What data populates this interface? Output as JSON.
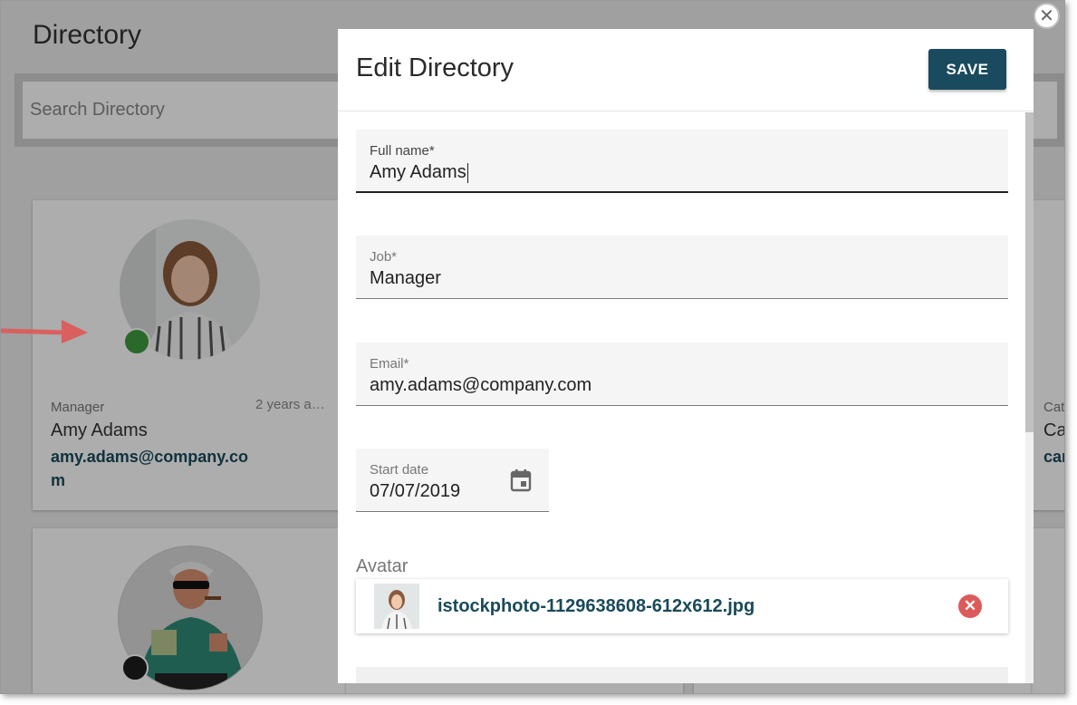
{
  "background": {
    "title": "Directory",
    "search_placeholder": "Search Directory",
    "cards": [
      {
        "job": "Manager",
        "time": "2 years a…",
        "name": "Amy Adams",
        "email": "amy.adams@company.com",
        "status_color": "#3f9b3f"
      },
      {
        "status_color": "#1d1d1d"
      }
    ],
    "partial_card": {
      "category": "Cat",
      "name": "Ca",
      "email": "cam"
    }
  },
  "dialog": {
    "title": "Edit Directory",
    "save_label": "SAVE",
    "fields": {
      "full_name": {
        "label": "Full name*",
        "value": "Amy Adams"
      },
      "job": {
        "label": "Job*",
        "value": "Manager"
      },
      "email": {
        "label": "Email*",
        "value": "amy.adams@company.com"
      },
      "start_date": {
        "label": "Start date",
        "value": "07/07/2019",
        "icon": "calendar-icon"
      }
    },
    "avatar": {
      "label": "Avatar",
      "file_name": "istockphoto-1129638608-612x612.jpg",
      "remove_icon": "close-circle-icon"
    }
  },
  "colors": {
    "accent": "#1a4a5e",
    "link": "#1a4a5a",
    "remove": "#dd5a5a",
    "online": "#3f9b3f"
  },
  "close_icon": "close-icon"
}
